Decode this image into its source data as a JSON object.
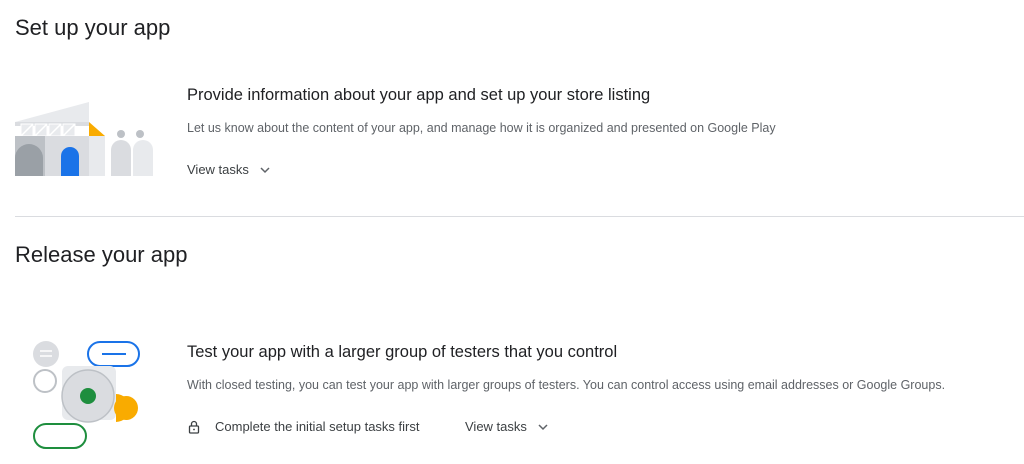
{
  "sections": [
    {
      "title": "Set up your app",
      "card": {
        "title": "Provide information about your app and set up your store listing",
        "description": "Let us know about the content of your app, and manage how it is organized and presented on Google Play",
        "view_tasks_label": "View tasks",
        "icon": "store-listing-illustration"
      }
    },
    {
      "title": "Release your app",
      "card": {
        "title": "Test your app with a larger group of testers that you control",
        "description": "With closed testing, you can test your app with larger groups of testers. You can control access using email addresses or Google Groups.",
        "lock_text": "Complete the initial setup tasks first",
        "view_tasks_label": "View tasks",
        "icon": "closed-testing-illustration"
      }
    }
  ],
  "icons": {
    "chevron": "chevron-down-icon",
    "lock": "lock-icon"
  },
  "colors": {
    "text_primary": "#202124",
    "text_secondary": "#5f6368",
    "divider": "#dadce0",
    "blue": "#1a73e8",
    "yellow": "#f9ab00",
    "green": "#1e8e3e",
    "grey": "#bdc1c6"
  }
}
